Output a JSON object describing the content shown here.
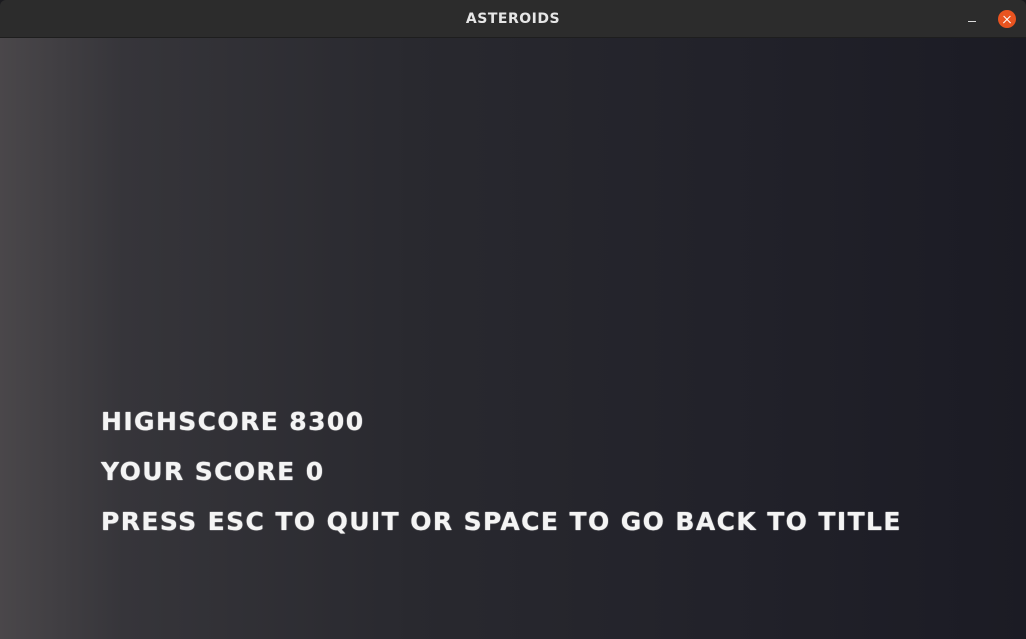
{
  "window": {
    "title": "ASTEROIDS",
    "minimize_icon": "minimize-icon",
    "close_icon": "close-icon",
    "close_color": "#e95420"
  },
  "game_over": {
    "highscore_text": "HIGHSCORE 8300",
    "your_score_text": "YOUR SCORE 0",
    "instructions_text": "PRESS ESC TO QUIT OR SPACE TO GO BACK TO TITLE"
  }
}
